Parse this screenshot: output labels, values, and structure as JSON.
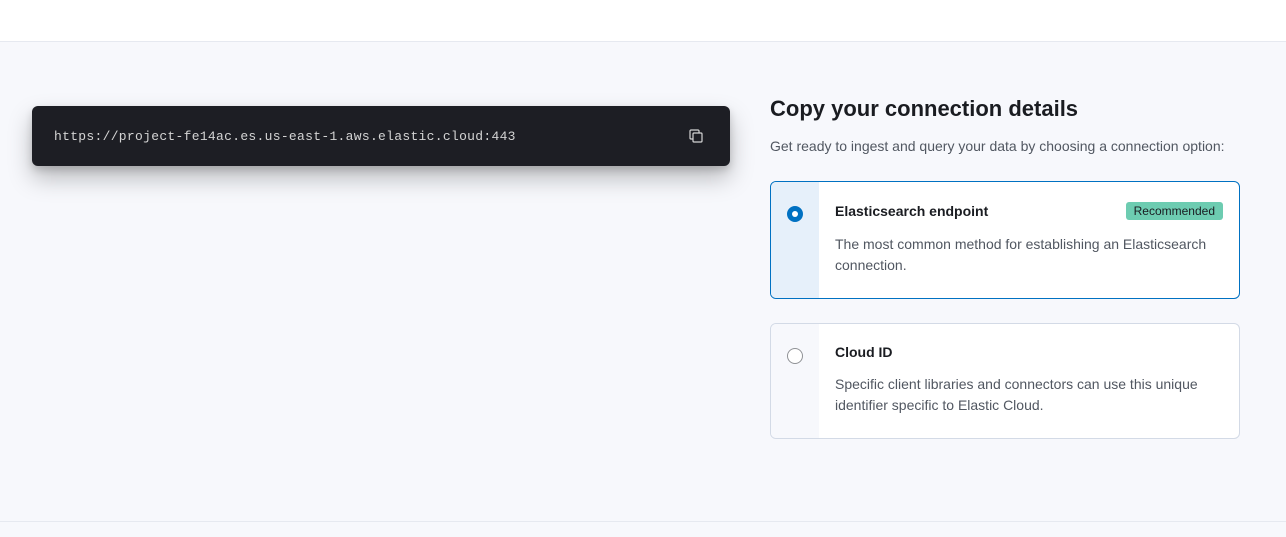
{
  "connection": {
    "endpoint": "https://project-fe14ac.es.us-east-1.aws.elastic.cloud:443"
  },
  "section": {
    "title": "Copy your connection details",
    "description": "Get ready to ingest and query your data by choosing a connection option:"
  },
  "options": [
    {
      "title": "Elasticsearch endpoint",
      "badge": "Recommended",
      "description": "The most common method for establishing an Elasticsearch connection."
    },
    {
      "title": "Cloud ID",
      "badge": "",
      "description": "Specific client libraries and connectors can use this unique identifier specific to Elastic Cloud."
    }
  ]
}
